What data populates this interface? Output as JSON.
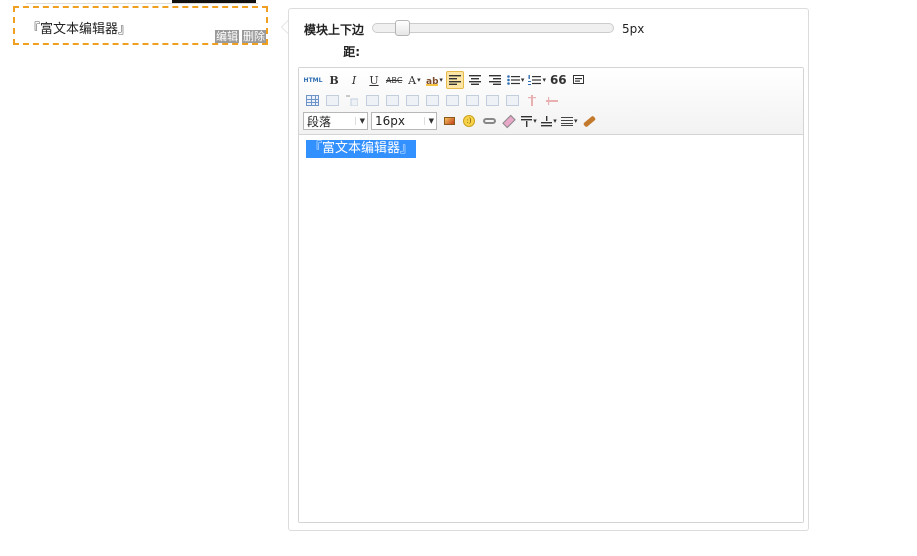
{
  "module": {
    "text": "『富文本编辑器』",
    "edit_label": "编辑",
    "delete_label": "删除"
  },
  "settings": {
    "margin_label_line1": "模块上下边",
    "margin_label_line2": "距:",
    "margin_value": "5px",
    "margin_fraction": 0.1
  },
  "toolbar": {
    "html_label": "HTML",
    "bold": "B",
    "italic": "I",
    "underline": "U",
    "strike": "ABC",
    "font_color": "A",
    "quote": "66",
    "paragraph_select": "段落",
    "fontsize_select": "16px",
    "row1_icons": [
      "source-icon",
      "bold-icon",
      "italic-icon",
      "underline-icon",
      "strikethrough-icon",
      "font-color-icon",
      "highlight-icon",
      "align-left-icon",
      "align-center-icon",
      "align-right-icon",
      "unordered-list-icon",
      "ordered-list-icon",
      "blockquote-icon",
      "clear-format-icon"
    ],
    "row2_icons": [
      "insert-table-icon",
      "delete-table-icon",
      "insert-caption-icon",
      "insert-row-above-icon",
      "delete-row-icon",
      "insert-col-icon",
      "delete-col-icon",
      "merge-cells-icon",
      "merge-right-icon",
      "merge-down-icon",
      "split-cells-icon",
      "split-rows-icon",
      "split-cols-icon"
    ],
    "row3_icons": [
      "image-icon",
      "emotion-icon",
      "link-icon",
      "eraser-icon",
      "paragraph-before-icon",
      "paragraph-after-icon",
      "line-height-icon",
      "format-brush-icon"
    ],
    "active_color": "#fde6a5",
    "accent_color": "#2f6fb3"
  },
  "editor": {
    "content_text": "『富文本编辑器』",
    "selection_color": "#3390ff"
  },
  "colors": {
    "module_border": "#f0a020"
  }
}
